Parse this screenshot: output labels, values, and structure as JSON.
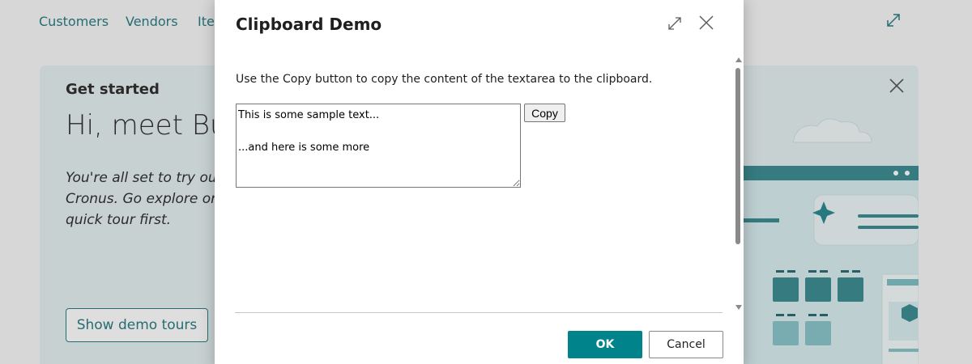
{
  "nav": {
    "items": [
      "Customers",
      "Vendors",
      "Ite"
    ]
  },
  "card": {
    "eyebrow": "Get started",
    "hero": "Hi, meet Bus",
    "body_lines": [
      "You're all set to try out",
      "Cronus. Go explore on",
      "quick tour first."
    ],
    "button_label": "Show demo tours"
  },
  "dialog": {
    "title": "Clipboard Demo",
    "description": "Use the Copy button to copy the content of the textarea to the clipboard.",
    "textarea_value": "This is some sample text...\n\n...and here is some more",
    "copy_label": "Copy",
    "ok_label": "OK",
    "cancel_label": "Cancel"
  },
  "icons": {
    "nav_expand": "expand-arrows-icon",
    "card_close": "close-icon",
    "dialog_expand": "expand-arrows-icon",
    "dialog_close": "close-icon"
  },
  "colors": {
    "accent": "#00838a",
    "nav_text": "#2c7d85",
    "card_bg": "#e6f1f2"
  }
}
